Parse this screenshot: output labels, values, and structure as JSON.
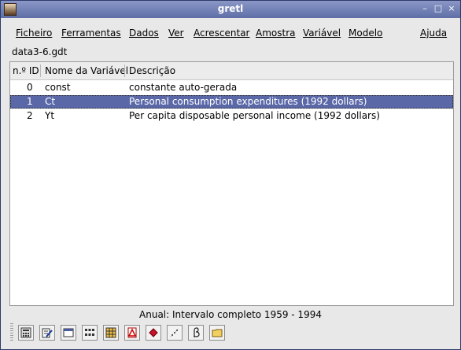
{
  "window": {
    "title": "gretl"
  },
  "titlebar_controls": [
    "–",
    "□",
    "×"
  ],
  "menu": [
    {
      "label": "Ficheiro"
    },
    {
      "label": "Ferramentas"
    },
    {
      "label": "Dados"
    },
    {
      "label": "Ver"
    },
    {
      "label": "Acrescentar"
    },
    {
      "label": "Amostra"
    },
    {
      "label": "Variável"
    },
    {
      "label": "Modelo"
    },
    {
      "label": "Ajuda"
    }
  ],
  "file": {
    "name": "data3-6.gdt"
  },
  "table": {
    "headers": {
      "id": "n.º ID",
      "name": "Nome da Variável",
      "desc": "Descrição"
    },
    "rows": [
      {
        "id": "0",
        "name": "const",
        "desc": "constante auto-gerada"
      },
      {
        "id": "1",
        "name": "Ct",
        "desc": "Personal consumption expenditures (1992 dollars)"
      },
      {
        "id": "2",
        "name": "Yt",
        "desc": "Per capita disposable personal income (1992 dollars)"
      }
    ],
    "selected_row": 1
  },
  "status": {
    "text": "Anual: Intervalo completo 1959 - 1994"
  },
  "toolbar": [
    {
      "icon": "calculator-icon"
    },
    {
      "icon": "script-edit-icon"
    },
    {
      "icon": "terminal-icon"
    },
    {
      "icon": "session-icon"
    },
    {
      "icon": "data-grid-icon"
    },
    {
      "icon": "pdf-icon"
    },
    {
      "icon": "ruby-icon"
    },
    {
      "icon": "scatter-plot-icon"
    },
    {
      "icon": "beta-model-icon"
    },
    {
      "icon": "open-folder-icon"
    }
  ]
}
